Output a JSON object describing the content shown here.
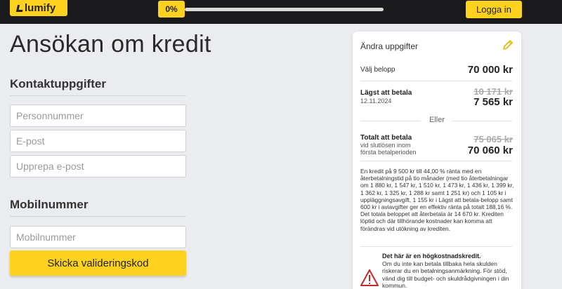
{
  "header": {
    "logo_text": "lumify",
    "progress_label": "0%",
    "progress_value": 0,
    "login_label": "Logga in"
  },
  "form": {
    "title": "Ansökan om kredit",
    "contact_heading": "Kontaktuppgifter",
    "personnummer_placeholder": "Personnummer",
    "email_placeholder": "E-post",
    "email_repeat_placeholder": "Upprepa e-post",
    "mobile_heading": "Mobilnummer",
    "mobile_placeholder": "Mobilnummer",
    "send_code_label": "Skicka valideringskod"
  },
  "summary": {
    "edit_label": "Ändra uppgifter",
    "amount_label": "Välj belopp",
    "amount_value": "70 000 kr",
    "lowest_label": "Lägst att betala",
    "lowest_date": "12.11.2024",
    "lowest_old": "10 171 kr",
    "lowest_value": "7 565 kr",
    "or_label": "Eller",
    "total_label": "Totalt att betala",
    "total_sub1": "vid slutlösen inom",
    "total_sub2": "första betalperioden",
    "total_old": "75 065 kr",
    "total_value": "70 060 kr",
    "disclaimer": "En kredit på 9 500 kr till 44,00 % ränta med en återbetalningstid på tio månader (med tio återbetalningar om 1 880 kr, 1 547 kr, 1 510 kr, 1 473 kr, 1 436 kr, 1 399 kr, 1 362 kr, 1 325 kr, 1 288 kr samt 1 251 kr) och 1 105 kr i uppläggningsavgift, 1 155 kr i Lägst att betala-belopp samt 600 kr i aviavgifter ger en effektiv ränta på totalt 188,16 %. Det totala beloppet att återbetala är 14 670 kr. Krediten löptid och där tillhörande kostnader kan komma att förändras vid utökning av krediten.",
    "warning_title": "Det här är en högkostnadskredit.",
    "warning_text": "Om du inte kan betala tillbaka hela skulden riskerar du en betalningsanmärkning. För stöd, vänd dig till budget- och skuldrådgivningen i din kommun."
  },
  "colors": {
    "accent": "#ffd21f",
    "header_bg": "#1a1a1c",
    "page_bg": "#ebecef",
    "warning": "#c62828"
  }
}
